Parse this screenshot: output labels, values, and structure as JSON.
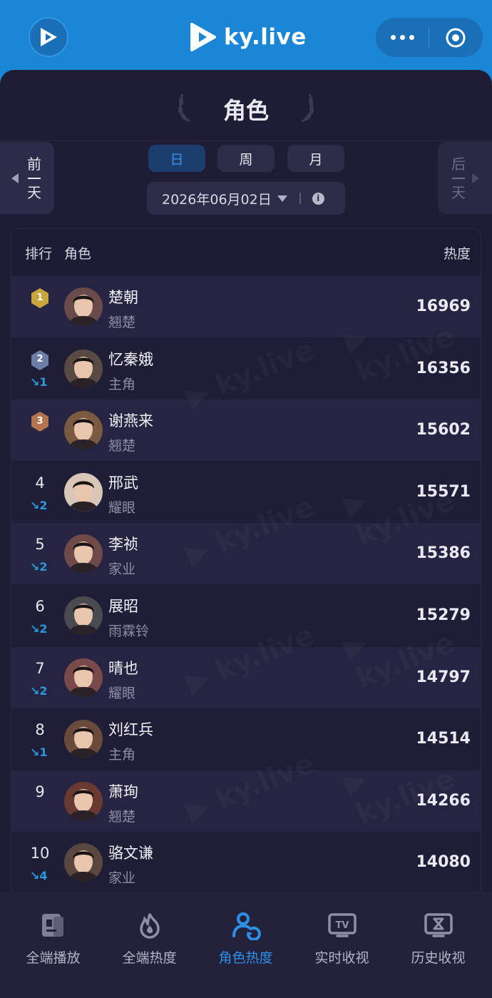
{
  "app": {
    "brand": "ky.live",
    "brand_color": "#1b86d6",
    "accent_color": "#2e8fe6"
  },
  "header": {
    "title": "角色",
    "prev_day_label": [
      "前",
      "天"
    ],
    "next_day_label": [
      "后",
      "天"
    ],
    "period_tabs": [
      {
        "label": "日",
        "active": true
      },
      {
        "label": "周",
        "active": false
      },
      {
        "label": "月",
        "active": false
      }
    ],
    "date": "2026年06月02日"
  },
  "table": {
    "headers": {
      "rank": "排行",
      "role": "角色",
      "heat": "热度"
    },
    "rows": [
      {
        "rank": "1",
        "medal": "gold",
        "change": "",
        "name": "楚朝",
        "drama": "翘楚",
        "heat": "16969"
      },
      {
        "rank": "2",
        "medal": "silver",
        "change": "↘1",
        "name": "忆秦娥",
        "drama": "主角",
        "heat": "16356"
      },
      {
        "rank": "3",
        "medal": "bronze",
        "change": "",
        "name": "谢燕来",
        "drama": "翘楚",
        "heat": "15602"
      },
      {
        "rank": "4",
        "medal": "",
        "change": "↘2",
        "name": "邢武",
        "drama": "耀眼",
        "heat": "15571"
      },
      {
        "rank": "5",
        "medal": "",
        "change": "↘2",
        "name": "李祯",
        "drama": "家业",
        "heat": "15386"
      },
      {
        "rank": "6",
        "medal": "",
        "change": "↘2",
        "name": "展昭",
        "drama": "雨霖铃",
        "heat": "15279"
      },
      {
        "rank": "7",
        "medal": "",
        "change": "↘2",
        "name": "晴也",
        "drama": "耀眼",
        "heat": "14797"
      },
      {
        "rank": "8",
        "medal": "",
        "change": "↘1",
        "name": "刘红兵",
        "drama": "主角",
        "heat": "14514"
      },
      {
        "rank": "9",
        "medal": "",
        "change": "",
        "name": "萧珣",
        "drama": "翘楚",
        "heat": "14266"
      },
      {
        "rank": "10",
        "medal": "",
        "change": "↘4",
        "name": "骆文谦",
        "drama": "家业",
        "heat": "14080"
      }
    ]
  },
  "tabbar": {
    "items": [
      {
        "label": "全端播放",
        "icon": "document-icon",
        "active": false
      },
      {
        "label": "全端热度",
        "icon": "flame-icon",
        "active": false
      },
      {
        "label": "角色热度",
        "icon": "user-refresh-icon",
        "active": true
      },
      {
        "label": "实时收视",
        "icon": "tv-icon",
        "active": false
      },
      {
        "label": "历史收视",
        "icon": "history-tv-icon",
        "active": false
      }
    ]
  }
}
